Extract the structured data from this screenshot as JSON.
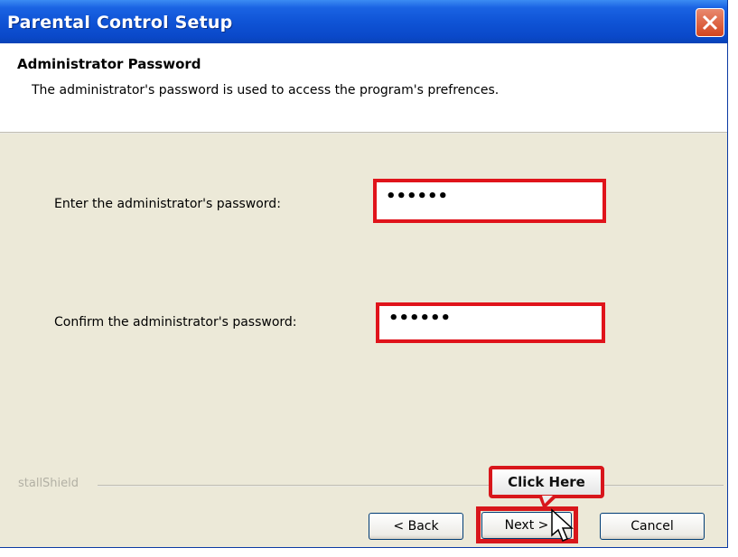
{
  "window": {
    "title": "Parental Control Setup",
    "close_icon": "close-icon"
  },
  "header": {
    "title": "Administrator Password",
    "description": "The administrator's password is used to access the program's prefrences."
  },
  "form": {
    "password_label": "Enter the administrator's password:",
    "password_value": "••••••",
    "confirm_label": "Confirm the administrator's password:",
    "confirm_value": "••••••"
  },
  "footer": {
    "brand": "stallShield"
  },
  "buttons": {
    "back": "< Back",
    "next": "Next >",
    "cancel": "Cancel"
  },
  "annotation": {
    "callout": "Click Here",
    "highlight_color": "#e0141b"
  },
  "colors": {
    "titlebar": "#0f54d6",
    "panel": "#ece9d8",
    "header_bg": "#ffffff"
  }
}
